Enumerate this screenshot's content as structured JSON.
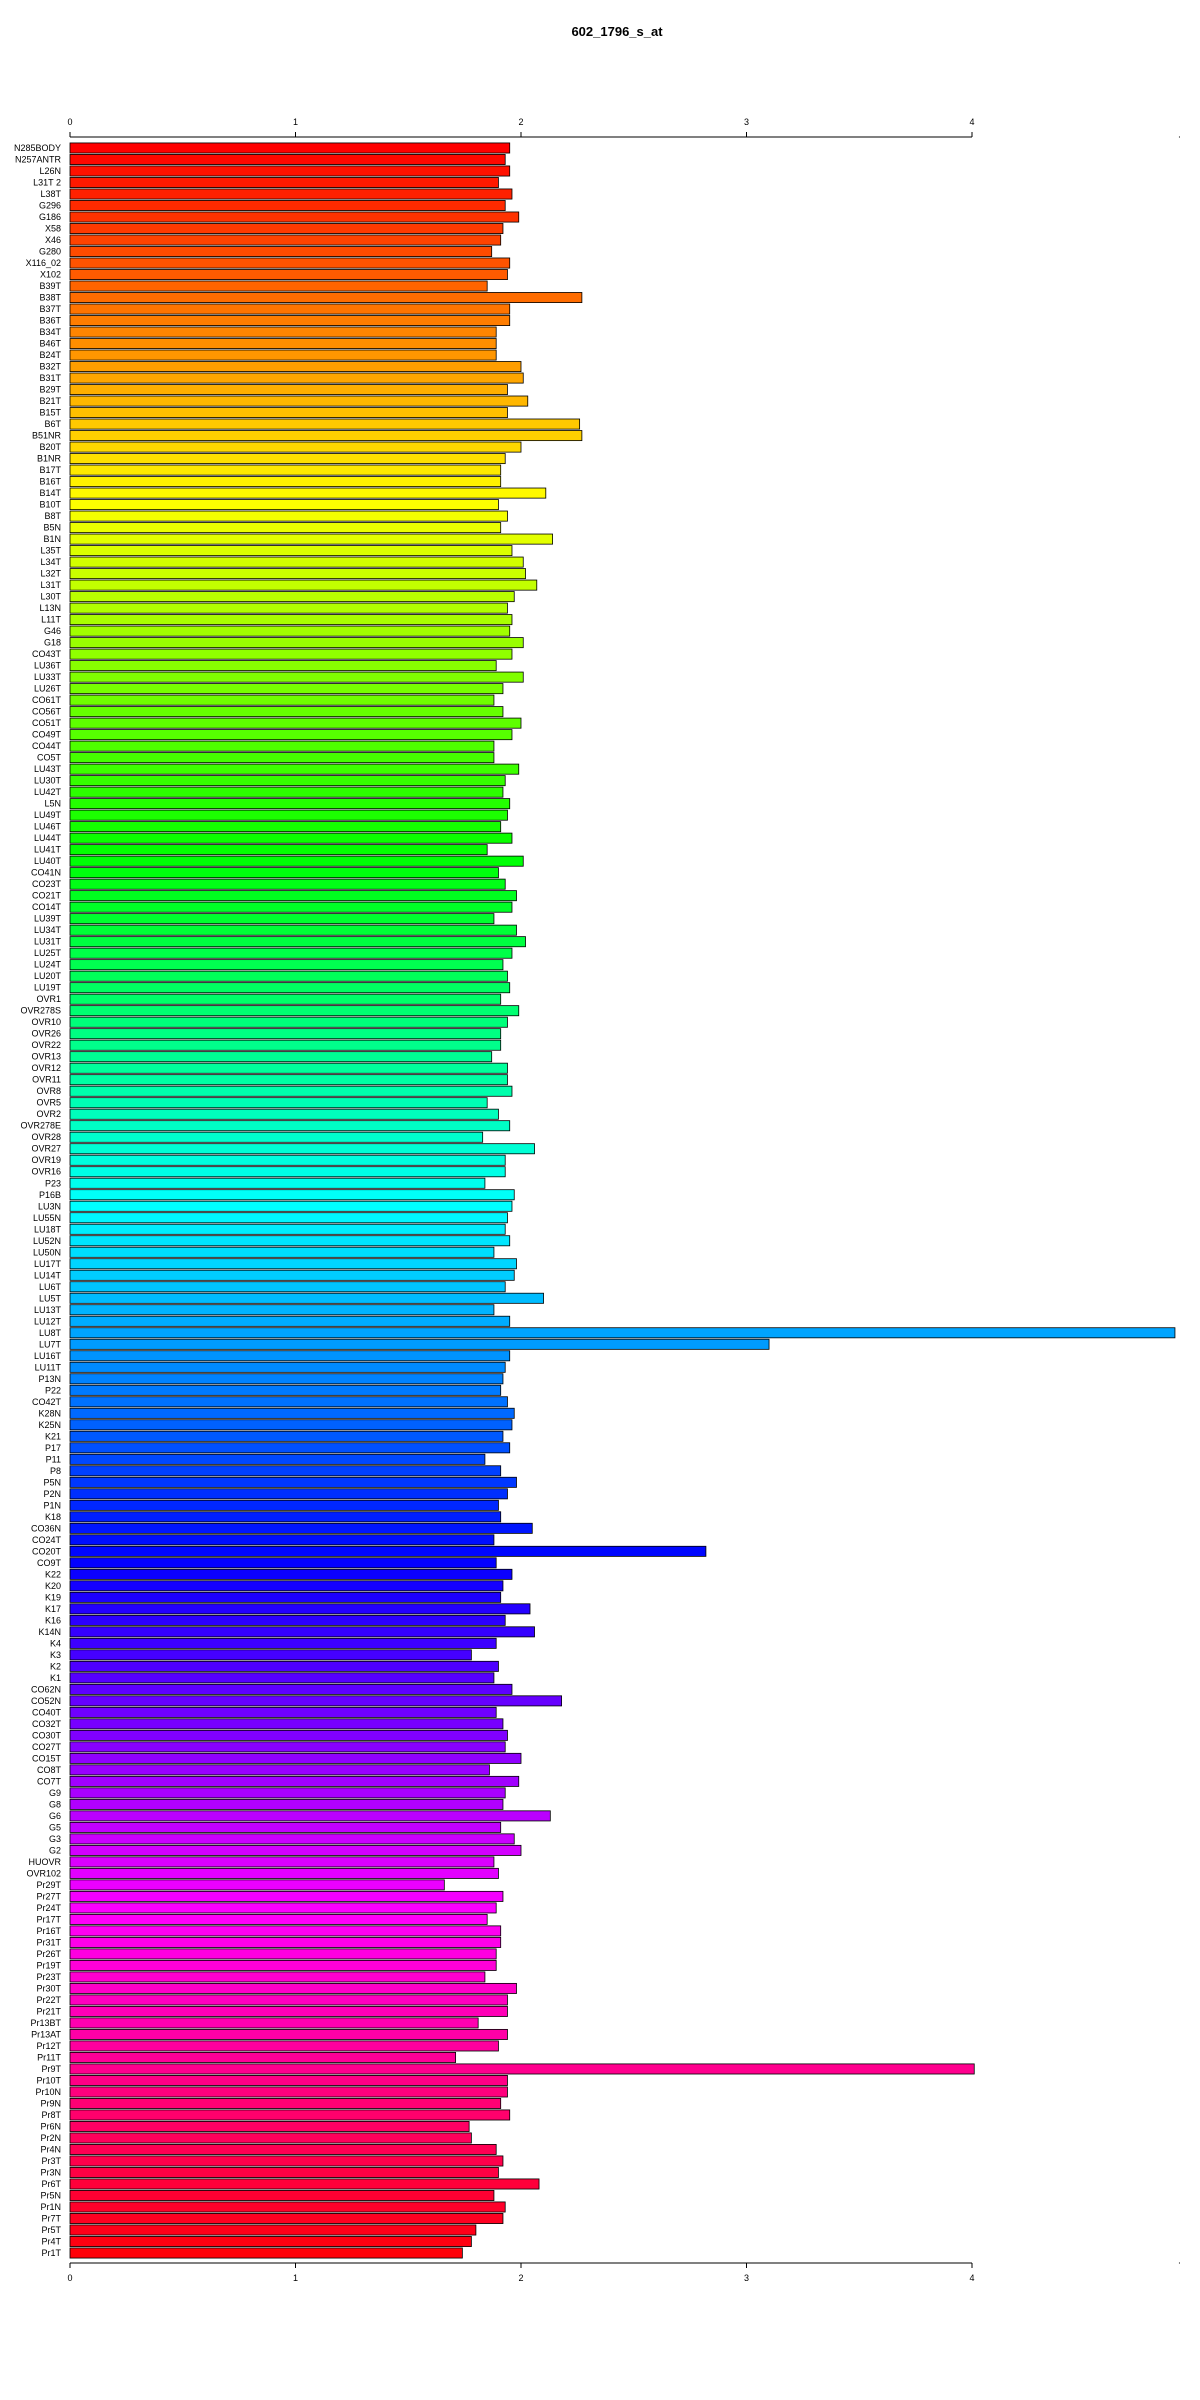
{
  "chart_data": {
    "type": "bar",
    "orientation": "horizontal",
    "title": "602_1796_s_at",
    "xlabel": "",
    "ylabel": "",
    "xlim": [
      0,
      4.9
    ],
    "x_ticks": [
      "0",
      "1",
      "2",
      "3",
      "4"
    ],
    "grid": false,
    "legend": "none",
    "color_scheme": "rainbow (red → magenta → blue → cyan → green → yellow → orange → red, top to bottom)",
    "categories": [
      "N285BODY",
      "N257ANTR",
      "L26N",
      "L31T 2",
      "L38T",
      "G296",
      "G186",
      "X58",
      "X46",
      "G280",
      "X116_02",
      "X102",
      "B39T",
      "B38T",
      "B37T",
      "B36T",
      "B34T",
      "B46T",
      "B24T",
      "B32T",
      "B31T",
      "B29T",
      "B21T",
      "B15T",
      "B6T",
      "B51NR",
      "B20T",
      "B1NR",
      "B17T",
      "B16T",
      "B14T",
      "B10T",
      "B8T",
      "B5N",
      "B1N",
      "L35T",
      "L34T",
      "L32T",
      "L31T",
      "L30T",
      "L13N",
      "L11T",
      "G46",
      "G18",
      "CO43T",
      "LU36T",
      "LU33T",
      "LU26T",
      "CO61T",
      "CO56T",
      "CO51T",
      "CO49T",
      "CO44T",
      "CO5T",
      "LU43T",
      "LU30T",
      "LU42T",
      "L5N",
      "LU49T",
      "LU46T",
      "LU44T",
      "LU41T",
      "LU40T",
      "CO41N",
      "CO23T",
      "CO21T",
      "CO14T",
      "LU39T",
      "LU34T",
      "LU31T",
      "LU25T",
      "LU24T",
      "LU20T",
      "LU19T",
      "OVR1",
      "OVR278S",
      "OVR10",
      "OVR26",
      "OVR22",
      "OVR13",
      "OVR12",
      "OVR11",
      "OVR8",
      "OVR5",
      "OVR2",
      "OVR278E",
      "OVR28",
      "OVR27",
      "OVR19",
      "OVR16",
      "P23",
      "P16B",
      "LU3N",
      "LU55N",
      "LU18T",
      "LU52N",
      "LU50N",
      "LU17T",
      "LU14T",
      "LU6T",
      "LU5T",
      "LU13T",
      "LU12T",
      "LU8T",
      "LU7T",
      "LU16T",
      "LU11T",
      "P13N",
      "P22",
      "CO42T",
      "K28N",
      "K25N",
      "K21",
      "P17",
      "P11",
      "P8",
      "P5N",
      "P2N",
      "P1N",
      "K18",
      "CO36N",
      "CO24T",
      "CO20T",
      "CO9T",
      "K22",
      "K20",
      "K19",
      "K17",
      "K16",
      "K14N",
      "K4",
      "K3",
      "K2",
      "K1",
      "CO62N",
      "CO52N",
      "CO40T",
      "CO32T",
      "CO30T",
      "CO27T",
      "CO15T",
      "CO8T",
      "CO7T",
      "G9",
      "G8",
      "G6",
      "G5",
      "G3",
      "G2",
      "HUOVR",
      "OVR102",
      "Pr29T",
      "Pr27T",
      "Pr24T",
      "Pr17T",
      "Pr16T",
      "Pr31T",
      "Pr26T",
      "Pr19T",
      "Pr23T",
      "Pr30T",
      "Pr22T",
      "Pr21T",
      "Pr13BT",
      "Pr13AT",
      "Pr12T",
      "Pr11T",
      "Pr9T",
      "Pr10T",
      "Pr10N",
      "Pr9N",
      "Pr8T",
      "Pr6N",
      "Pr2N",
      "Pr4N",
      "Pr3T",
      "Pr3N",
      "Pr6T",
      "Pr5N",
      "Pr1N",
      "Pr7T",
      "Pr5T",
      "Pr4T",
      "Pr1T"
    ],
    "values": [
      1.95,
      1.93,
      1.95,
      1.9,
      1.96,
      1.93,
      1.99,
      1.92,
      1.91,
      1.87,
      1.95,
      1.94,
      1.85,
      2.27,
      1.95,
      1.95,
      1.89,
      1.89,
      1.89,
      2,
      2.01,
      1.94,
      2.03,
      1.94,
      2.26,
      2.27,
      2,
      1.93,
      1.91,
      1.91,
      2.11,
      1.9,
      1.94,
      1.91,
      2.14,
      1.96,
      2.01,
      2.02,
      2.07,
      1.97,
      1.94,
      1.96,
      1.95,
      2.01,
      1.96,
      1.89,
      2.01,
      1.92,
      1.88,
      1.92,
      2,
      1.96,
      1.88,
      1.88,
      1.99,
      1.93,
      1.92,
      1.95,
      1.94,
      1.91,
      1.96,
      1.85,
      2.01,
      1.9,
      1.93,
      1.98,
      1.96,
      1.88,
      1.98,
      2.02,
      1.96,
      1.92,
      1.94,
      1.95,
      1.91,
      1.99,
      1.94,
      1.91,
      1.91,
      1.87,
      1.94,
      1.94,
      1.96,
      1.85,
      1.9,
      1.95,
      1.83,
      2.06,
      1.93,
      1.93,
      1.84,
      1.97,
      1.96,
      1.94,
      1.93,
      1.95,
      1.88,
      1.98,
      1.97,
      1.93,
      2.1,
      1.88,
      1.95,
      4.9,
      3.1,
      1.95,
      1.93,
      1.92,
      1.91,
      1.94,
      1.97,
      1.96,
      1.92,
      1.95,
      1.84,
      1.91,
      1.98,
      1.94,
      1.9,
      1.91,
      2.05,
      1.88,
      2.82,
      1.89,
      1.96,
      1.92,
      1.91,
      2.04,
      1.93,
      2.06,
      1.89,
      1.78,
      1.9,
      1.88,
      1.96,
      2.18,
      1.89,
      1.92,
      1.94,
      1.93,
      2,
      1.86,
      1.99,
      1.93,
      1.92,
      2.13,
      1.91,
      1.97,
      2,
      1.88,
      1.9,
      1.66,
      1.92,
      1.89,
      1.85,
      1.91,
      1.91,
      1.89,
      1.89,
      1.84,
      1.98,
      1.94,
      1.94,
      1.81,
      1.94,
      1.9,
      1.71,
      4.01,
      1.94,
      1.94,
      1.91,
      1.95,
      1.77,
      1.78,
      1.89,
      1.92,
      1.9,
      2.08,
      1.88,
      1.93,
      1.92,
      1.8,
      1.78,
      1.74
    ]
  }
}
